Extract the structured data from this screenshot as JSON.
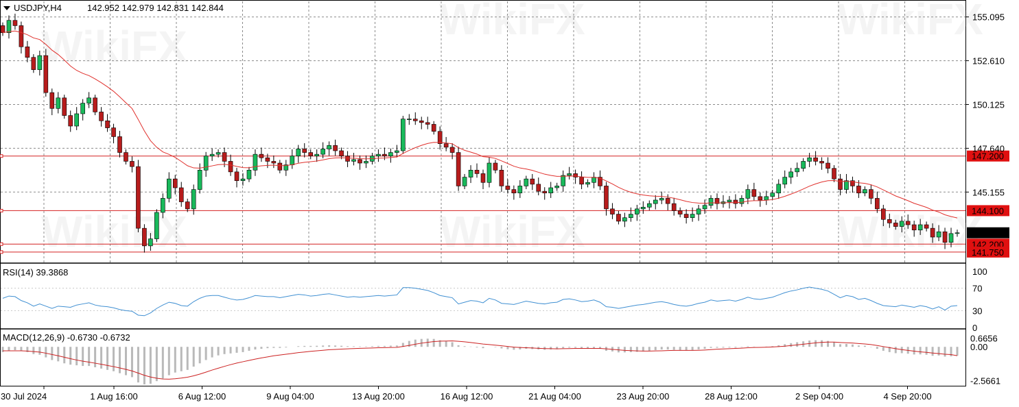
{
  "header": {
    "symbol": "USDJPY,H4",
    "ohlc": "142.952 142.979 142.831 142.844"
  },
  "watermark": "WikiFX",
  "colors": {
    "bull": "#19b95b",
    "bear": "#b71c1c",
    "ma": "#e0302c",
    "level": "#d42020",
    "rsi": "#3f8fd2",
    "macd_hist": "#b9b9b9",
    "macd_signal": "#cc2020",
    "grid": "#8a8a8a",
    "price_tag_bg": "#000000",
    "level_tag_bg": "#e01010"
  },
  "chart_data": [
    {
      "type": "candlestick",
      "name": "price",
      "ylim": [
        141.2,
        155.9
      ],
      "y_ticks": [
        "155.095",
        "152.610",
        "150.125",
        "147.640",
        "145.155"
      ],
      "x_ticks": [
        "30 Jul 2024",
        "1 Aug 16:00",
        "6 Aug 12:00",
        "9 Aug 04:00",
        "13 Aug 20:00",
        "16 Aug 12:00",
        "21 Aug 04:00",
        "23 Aug 20:00",
        "28 Aug 12:00",
        "2 Sep 04:00",
        "4 Sep 20:00"
      ],
      "current_price": "142.844",
      "levels": [
        {
          "label": "147.200",
          "value": 147.2
        },
        {
          "label": "144.100",
          "value": 144.1
        },
        {
          "label": "142.200",
          "value": 142.2
        },
        {
          "label": "141.750",
          "value": 141.75
        }
      ],
      "closes": [
        154.2,
        154.9,
        154.6,
        153.4,
        152.8,
        152.1,
        152.9,
        150.8,
        149.9,
        150.5,
        149.5,
        148.9,
        149.6,
        150.2,
        150.5,
        149.7,
        149.2,
        148.8,
        148.3,
        147.4,
        146.9,
        146.6,
        143.1,
        142.1,
        142.5,
        144.0,
        144.8,
        145.9,
        145.4,
        144.6,
        144.2,
        145.3,
        146.4,
        147.2,
        147.3,
        147.4,
        146.9,
        146.3,
        145.8,
        145.9,
        146.4,
        147.3,
        147.1,
        146.9,
        146.8,
        146.4,
        146.7,
        147.2,
        147.6,
        147.4,
        147.2,
        147.3,
        147.6,
        147.8,
        147.5,
        147.2,
        146.9,
        147.0,
        146.8,
        146.9,
        147.2,
        147.3,
        147.2,
        147.4,
        147.5,
        149.3,
        149.3,
        149.2,
        149.1,
        149.0,
        148.6,
        147.9,
        147.7,
        147.4,
        145.5,
        146.0,
        146.4,
        146.2,
        145.7,
        146.8,
        146.4,
        145.5,
        145.3,
        145.1,
        145.5,
        145.9,
        145.6,
        145.2,
        145.1,
        145.4,
        145.5,
        146.1,
        146.2,
        146.0,
        145.6,
        145.7,
        146.0,
        145.5,
        144.2,
        143.9,
        143.5,
        143.7,
        143.9,
        144.2,
        144.3,
        144.5,
        144.7,
        144.8,
        144.5,
        144.1,
        143.9,
        143.7,
        143.9,
        144.2,
        144.4,
        144.8,
        144.5,
        144.6,
        144.7,
        144.5,
        144.8,
        145.3,
        144.9,
        144.7,
        144.9,
        145.1,
        145.6,
        146.0,
        146.3,
        146.5,
        146.9,
        147.1,
        146.9,
        146.8,
        146.5,
        145.9,
        145.3,
        145.8,
        145.5,
        145.1,
        145.3,
        144.8,
        144.2,
        143.6,
        143.4,
        143.2,
        143.5,
        143.3,
        143.0,
        143.3,
        143.1,
        142.6,
        142.9,
        142.3,
        142.8,
        142.844
      ]
    },
    {
      "type": "line",
      "name": "RSI(14) 39.3868",
      "ylim": [
        0,
        100
      ],
      "y_ticks": [
        "100",
        "70",
        "30",
        "0"
      ],
      "values": [
        52,
        56,
        55,
        48,
        44,
        38,
        42,
        38,
        34,
        38,
        37,
        36,
        40,
        42,
        44,
        40,
        38,
        37,
        35,
        32,
        30,
        29,
        22,
        21,
        26,
        34,
        40,
        45,
        43,
        39,
        38,
        46,
        52,
        56,
        57,
        57,
        54,
        51,
        49,
        50,
        53,
        57,
        56,
        55,
        55,
        53,
        55,
        57,
        59,
        58,
        56,
        57,
        59,
        60,
        58,
        56,
        54,
        55,
        54,
        55,
        56,
        57,
        56,
        57,
        58,
        71,
        71,
        70,
        68,
        66,
        62,
        57,
        55,
        53,
        42,
        45,
        48,
        47,
        44,
        52,
        49,
        43,
        42,
        41,
        44,
        47,
        45,
        43,
        42,
        44,
        45,
        50,
        51,
        49,
        46,
        47,
        49,
        45,
        37,
        36,
        34,
        36,
        38,
        40,
        41,
        43,
        45,
        46,
        44,
        41,
        39,
        38,
        40,
        43,
        45,
        49,
        47,
        48,
        49,
        47,
        50,
        54,
        51,
        50,
        52,
        54,
        58,
        62,
        65,
        67,
        70,
        72,
        70,
        68,
        65,
        59,
        53,
        57,
        55,
        50,
        52,
        48,
        43,
        39,
        38,
        37,
        40,
        38,
        36,
        39,
        37,
        33,
        37,
        31,
        38,
        39
      ]
    },
    {
      "type": "bar+line",
      "name": "MACD(12,26,9) -0.6730 -0.6732",
      "ylim": [
        -2.9,
        1.05
      ],
      "y_ticks": [
        "0.6656",
        "0.00",
        "-2.5661"
      ],
      "histogram": [
        -0.4,
        -0.3,
        -0.25,
        -0.3,
        -0.4,
        -0.55,
        -0.6,
        -0.8,
        -1.0,
        -1.1,
        -1.25,
        -1.35,
        -1.4,
        -1.45,
        -1.45,
        -1.55,
        -1.65,
        -1.75,
        -1.85,
        -2.0,
        -2.15,
        -2.3,
        -2.7,
        -2.85,
        -2.8,
        -2.6,
        -2.4,
        -2.15,
        -1.95,
        -1.85,
        -1.75,
        -1.5,
        -1.25,
        -1.0,
        -0.8,
        -0.65,
        -0.55,
        -0.5,
        -0.45,
        -0.4,
        -0.3,
        -0.2,
        -0.15,
        -0.1,
        -0.08,
        -0.08,
        -0.05,
        0.0,
        0.05,
        0.07,
        0.07,
        0.08,
        0.1,
        0.12,
        0.1,
        0.08,
        0.05,
        0.04,
        0.03,
        0.03,
        0.05,
        0.07,
        0.07,
        0.09,
        0.1,
        0.3,
        0.45,
        0.55,
        0.6,
        0.62,
        0.6,
        0.5,
        0.42,
        0.35,
        0.12,
        0.05,
        0.02,
        -0.05,
        -0.1,
        0.0,
        -0.03,
        -0.12,
        -0.18,
        -0.22,
        -0.2,
        -0.15,
        -0.17,
        -0.2,
        -0.22,
        -0.2,
        -0.18,
        -0.1,
        -0.06,
        -0.07,
        -0.12,
        -0.12,
        -0.1,
        -0.15,
        -0.3,
        -0.35,
        -0.42,
        -0.42,
        -0.4,
        -0.38,
        -0.35,
        -0.3,
        -0.25,
        -0.2,
        -0.2,
        -0.23,
        -0.25,
        -0.27,
        -0.25,
        -0.2,
        -0.15,
        -0.08,
        -0.07,
        -0.06,
        -0.05,
        -0.06,
        -0.03,
        0.05,
        0.02,
        0.0,
        0.02,
        0.05,
        0.12,
        0.2,
        0.28,
        0.35,
        0.42,
        0.48,
        0.5,
        0.5,
        0.45,
        0.35,
        0.2,
        0.22,
        0.18,
        0.1,
        0.08,
        -0.02,
        -0.15,
        -0.3,
        -0.4,
        -0.48,
        -0.48,
        -0.52,
        -0.58,
        -0.57,
        -0.6,
        -0.68,
        -0.66,
        -0.74,
        -0.72,
        -0.673
      ],
      "signal": [
        -0.3,
        -0.3,
        -0.3,
        -0.3,
        -0.32,
        -0.36,
        -0.4,
        -0.48,
        -0.58,
        -0.68,
        -0.79,
        -0.9,
        -1.0,
        -1.09,
        -1.16,
        -1.24,
        -1.32,
        -1.41,
        -1.5,
        -1.6,
        -1.71,
        -1.83,
        -1.99,
        -2.16,
        -2.29,
        -2.38,
        -2.44,
        -2.45,
        -2.42,
        -2.37,
        -2.3,
        -2.2,
        -2.07,
        -1.92,
        -1.76,
        -1.62,
        -1.48,
        -1.35,
        -1.23,
        -1.13,
        -1.03,
        -0.93,
        -0.84,
        -0.76,
        -0.68,
        -0.62,
        -0.56,
        -0.5,
        -0.44,
        -0.39,
        -0.34,
        -0.3,
        -0.26,
        -0.22,
        -0.2,
        -0.17,
        -0.15,
        -0.13,
        -0.11,
        -0.1,
        -0.09,
        -0.07,
        -0.06,
        -0.05,
        -0.04,
        0.03,
        0.11,
        0.2,
        0.28,
        0.34,
        0.4,
        0.43,
        0.44,
        0.45,
        0.42,
        0.38,
        0.33,
        0.27,
        0.21,
        0.17,
        0.13,
        0.08,
        0.03,
        -0.02,
        -0.05,
        -0.07,
        -0.09,
        -0.11,
        -0.13,
        -0.14,
        -0.15,
        -0.14,
        -0.13,
        -0.12,
        -0.12,
        -0.12,
        -0.12,
        -0.12,
        -0.15,
        -0.19,
        -0.23,
        -0.27,
        -0.29,
        -0.31,
        -0.32,
        -0.32,
        -0.31,
        -0.3,
        -0.28,
        -0.27,
        -0.27,
        -0.27,
        -0.27,
        -0.26,
        -0.24,
        -0.21,
        -0.18,
        -0.16,
        -0.14,
        -0.12,
        -0.1,
        -0.07,
        -0.05,
        -0.04,
        -0.03,
        -0.01,
        0.02,
        0.05,
        0.1,
        0.15,
        0.2,
        0.25,
        0.3,
        0.34,
        0.36,
        0.36,
        0.33,
        0.31,
        0.29,
        0.25,
        0.22,
        0.17,
        0.1,
        0.02,
        -0.06,
        -0.14,
        -0.21,
        -0.27,
        -0.33,
        -0.38,
        -0.42,
        -0.47,
        -0.51,
        -0.56,
        -0.59,
        -0.673
      ]
    }
  ]
}
